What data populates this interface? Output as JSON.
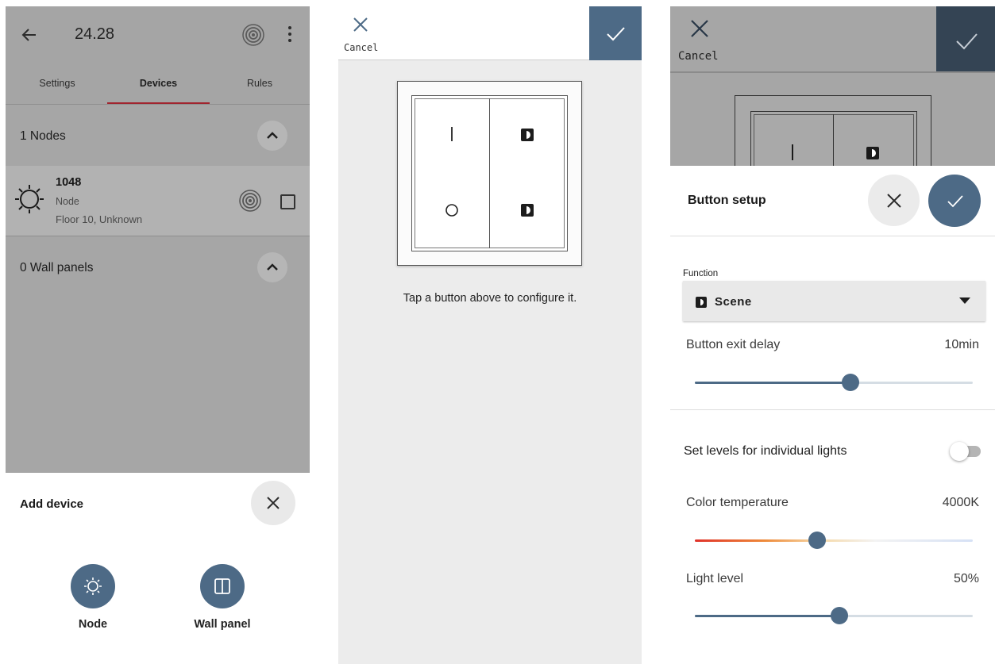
{
  "screen1": {
    "title": "24.28",
    "icons": {
      "back": "arrow-left-icon",
      "locate": "target-icon",
      "more": "more-vertical-icon"
    },
    "tabs": [
      {
        "label": "Settings",
        "active": false
      },
      {
        "label": "Devices",
        "active": true
      },
      {
        "label": "Rules",
        "active": false
      }
    ],
    "nodes_section": {
      "title": "1 Nodes",
      "items": [
        {
          "name": "1048",
          "type": "Node",
          "location": "Floor 10, Unknown"
        }
      ]
    },
    "wall_panels_section": {
      "title": "0 Wall panels"
    },
    "add_device": {
      "title": "Add device",
      "options": [
        {
          "label": "Node",
          "icon": "sun-icon"
        },
        {
          "label": "Wall panel",
          "icon": "panel-icon"
        }
      ]
    }
  },
  "screen2": {
    "cancel_label": "Cancel",
    "hint": "Tap a button above to configure it.",
    "panel_buttons": [
      {
        "position": "top-left",
        "symbol": "on"
      },
      {
        "position": "bottom-left",
        "symbol": "off"
      },
      {
        "position": "top-right",
        "symbol": "scene"
      },
      {
        "position": "bottom-right",
        "symbol": "scene"
      }
    ]
  },
  "screen3": {
    "cancel_label": "Cancel",
    "sheet_title": "Button setup",
    "function": {
      "label": "Function",
      "value": "Scene"
    },
    "exit_delay": {
      "label": "Button exit delay",
      "value": "10min",
      "fraction": 0.56
    },
    "individual_lights": {
      "label": "Set levels for individual lights",
      "enabled": false
    },
    "color_temperature": {
      "label": "Color temperature",
      "value": "4000K",
      "fraction": 0.44
    },
    "light_level": {
      "label": "Light level",
      "value": "50%",
      "fraction": 0.52
    }
  },
  "colors": {
    "accent": "#4d6a86",
    "tab_indicator": "#a1242e",
    "scrim": "#a6a6a6",
    "dark_confirm": "#344454"
  }
}
